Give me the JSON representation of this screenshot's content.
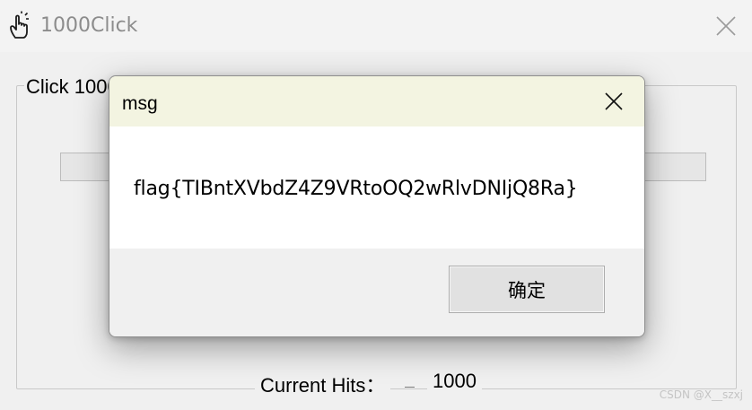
{
  "window": {
    "title": "1000Click",
    "icon": "hand-pointer-icon"
  },
  "main": {
    "group_label": "Click 1000",
    "progress_fraction": 1.0,
    "hits_label": "Current Hits：",
    "hits_value": "1000"
  },
  "dialog": {
    "title": "msg",
    "message": "flag{TIBntXVbdZ4Z9VRtoOQ2wRlvDNIjQ8Ra}",
    "ok_label": "确定"
  },
  "watermark": "CSDN @X__szxj",
  "colors": {
    "dialog_title_bg": "#f3f4e1",
    "window_bg": "#f0f0f0",
    "button_bg": "#e1e1e1"
  }
}
